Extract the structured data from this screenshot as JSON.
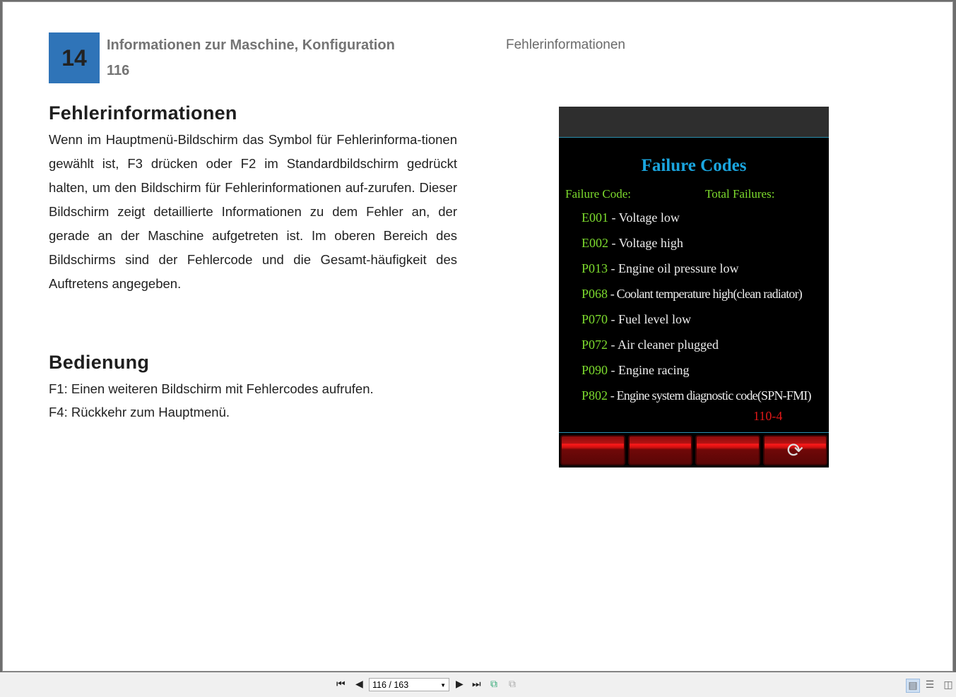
{
  "header": {
    "chapter_number": "14",
    "chapter_title": "Informationen zur Maschine, Konfiguration",
    "page_number": "116",
    "section_right": "Fehlerinformationen"
  },
  "section1": {
    "heading": "Fehlerinformationen",
    "body": "Wenn im Hauptmenü-Bildschirm das Symbol für Fehlerinforma-tionen gewählt ist, F3 drücken oder F2 im Standardbildschirm gedrückt halten, um den Bildschirm für Fehlerinformationen auf-zurufen. Dieser Bildschirm zeigt detaillierte Informationen zu dem Fehler an, der gerade an der Maschine aufgetreten ist. Im oberen Bereich des Bildschirms sind der Fehlercode und die Gesamt-häufigkeit des Auftretens angegeben."
  },
  "section2": {
    "heading": "Bedienung",
    "lines": [
      "F1: Einen weiteren Bildschirm mit Fehlercodes aufrufen.",
      "F4: Rückkehr zum Hauptmenü."
    ]
  },
  "screen": {
    "title": "Failure Codes",
    "label_code": "Failure Code:",
    "label_total": "Total Failures:",
    "codes": [
      {
        "code": "E001",
        "desc": " - Voltage low"
      },
      {
        "code": "E002",
        "desc": " - Voltage high"
      },
      {
        "code": "P013",
        "desc": " - Engine oil pressure low"
      },
      {
        "code": "P068",
        "desc": " - Coolant temperature high(clean radiator)"
      },
      {
        "code": "P070",
        "desc": " - Fuel level low"
      },
      {
        "code": "P072",
        "desc": " - Air cleaner  plugged"
      },
      {
        "code": "P090",
        "desc": " - Engine racing"
      },
      {
        "code": "P802",
        "desc": " - Engine system diagnostic code(SPN-FMI)"
      }
    ],
    "spn_fmi": "110-4",
    "colors": {
      "title": "#1aa6e0",
      "code": "#7ddc2e",
      "spn": "#e01818"
    }
  },
  "viewer": {
    "page_indicator": "116 / 163"
  }
}
